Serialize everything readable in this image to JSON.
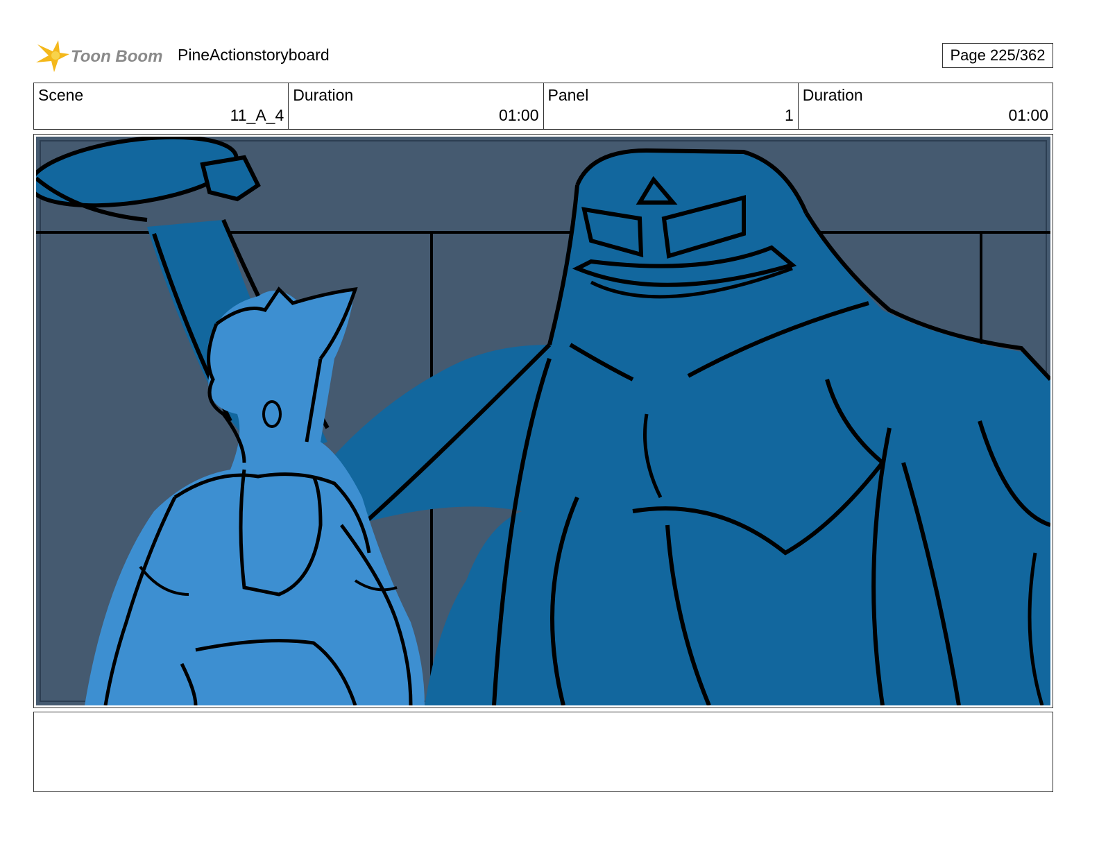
{
  "header": {
    "logo_text": "Toon Boom",
    "project_title": "PineActionstoryboard",
    "page_label": "Page 225/362"
  },
  "info": [
    {
      "label": "Scene",
      "value": "11_A_4"
    },
    {
      "label": "Duration",
      "value": "01:00"
    },
    {
      "label": "Panel",
      "value": "1"
    },
    {
      "label": "Duration",
      "value": "01:00"
    }
  ],
  "colors": {
    "background": "#455a70",
    "monster": "#12679e",
    "hero": "#3d8fd1",
    "lines": "#000000",
    "logo_star": "#f4b81b",
    "logo_text": "#8a8a8a"
  },
  "notes": {
    "action_text": ""
  }
}
